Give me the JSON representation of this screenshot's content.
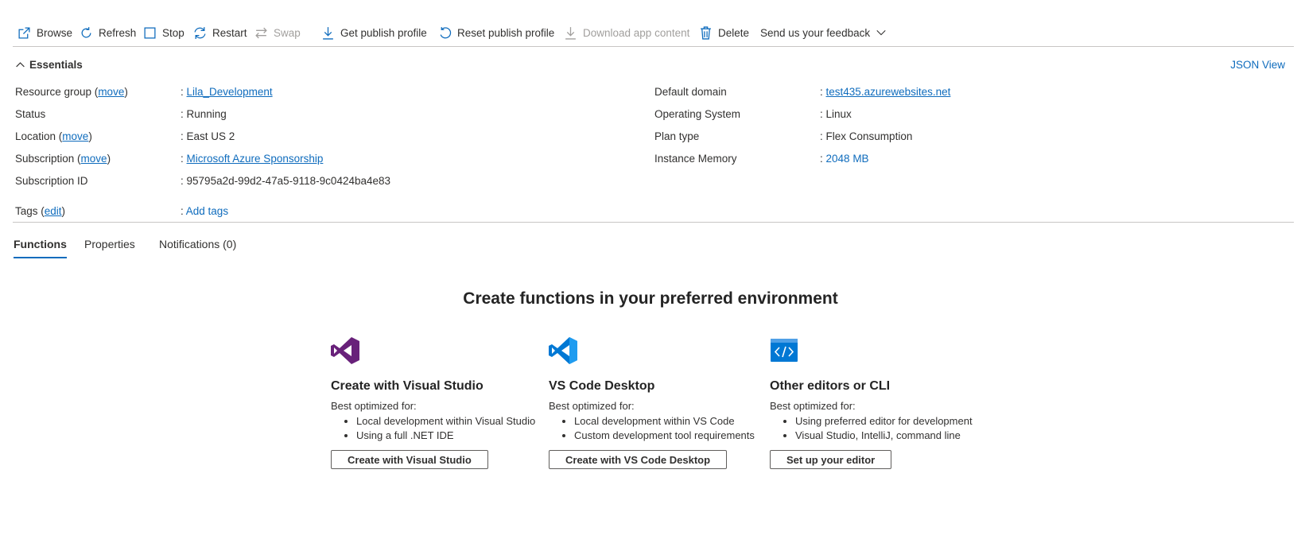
{
  "toolbar": {
    "browse": "Browse",
    "refresh": "Refresh",
    "stop": "Stop",
    "restart": "Restart",
    "swap": "Swap",
    "get_publish_profile": "Get publish profile",
    "reset_publish_profile": "Reset publish profile",
    "download_app_content": "Download app content",
    "delete": "Delete",
    "feedback": "Send us your feedback"
  },
  "essentials": {
    "title": "Essentials",
    "json_view": "JSON View",
    "left": {
      "resource_group": {
        "label": "Resource group (",
        "move": "move",
        "close": ")",
        "value": "Lila_Development"
      },
      "status": {
        "label": "Status",
        "value": "Running"
      },
      "location": {
        "label": "Location (",
        "move": "move",
        "close": ")",
        "value": "East US 2"
      },
      "subscription": {
        "label": "Subscription (",
        "move": "move",
        "close": ")",
        "value": "Microsoft Azure Sponsorship"
      },
      "subscription_id": {
        "label": "Subscription ID",
        "value": "95795a2d-99d2-47a5-9118-9c0424ba4e83"
      },
      "tags": {
        "label": "Tags (",
        "edit": "edit",
        "close": ")",
        "value": "Add tags"
      }
    },
    "right": {
      "default_domain": {
        "label": "Default domain",
        "value": "test435.azurewebsites.net"
      },
      "os": {
        "label": "Operating System",
        "value": "Linux"
      },
      "plan_type": {
        "label": "Plan type",
        "value": "Flex Consumption"
      },
      "instance_memory": {
        "label": "Instance Memory",
        "value": "2048 MB"
      }
    },
    "colon": ":"
  },
  "tabs": [
    "Functions",
    "Properties",
    "Notifications (0)"
  ],
  "active_tab": "Functions",
  "main": {
    "heading": "Create functions in your preferred environment",
    "cards": [
      {
        "title": "Create with Visual Studio",
        "best": "Best optimized for:",
        "bullets": [
          "Local development within Visual Studio",
          "Using a full .NET IDE"
        ],
        "button": "Create with Visual Studio",
        "icon": "visual-studio-icon"
      },
      {
        "title": "VS Code Desktop",
        "best": "Best optimized for:",
        "bullets": [
          "Local development within VS Code",
          "Custom development tool requirements"
        ],
        "button": "Create with VS Code Desktop",
        "icon": "vs-code-icon"
      },
      {
        "title": "Other editors or CLI",
        "best": "Best optimized for:",
        "bullets": [
          "Using preferred editor for development",
          "Visual Studio, IntelliJ, command line"
        ],
        "button": "Set up your editor",
        "icon": "code-editor-icon"
      }
    ]
  },
  "colors": {
    "accent": "#0f6cbd",
    "text": "#323130",
    "disabled": "#a19f9d",
    "vs_purple": "#68217a",
    "vscode_blue": "#0078d4"
  }
}
